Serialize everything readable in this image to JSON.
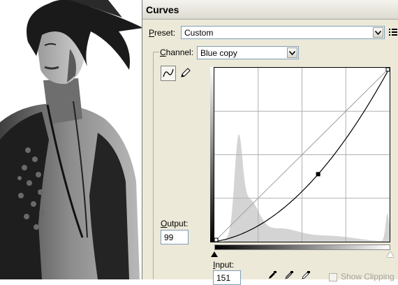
{
  "dialog": {
    "title": "Curves",
    "preset": {
      "label_key": "P",
      "label_rest": "reset:",
      "value": "Custom"
    },
    "channel": {
      "label_key": "C",
      "label_rest": "hannel:",
      "value": "Blue copy"
    },
    "output": {
      "label_key": "O",
      "label_rest": "utput:",
      "value": "99"
    },
    "input": {
      "label_key": "I",
      "label_rest": "nput:",
      "value": "151"
    },
    "show_clipping": "Show Clipping"
  },
  "curve": {
    "control_point": {
      "input": 151,
      "output": 99
    },
    "endpoints": [
      {
        "input": 0,
        "output": 0
      },
      {
        "input": 255,
        "output": 255
      }
    ]
  },
  "icons": {
    "preset_menu": "preset-options-icon",
    "curve_tool": "curve-edit-icon",
    "pencil_tool": "pencil-icon",
    "black_point": "black-eyedropper-icon",
    "gray_point": "gray-eyedropper-icon",
    "white_point": "white-eyedropper-icon"
  },
  "colors": {
    "dialog_bg": "#ece9d8",
    "field_border": "#7f9db9"
  }
}
